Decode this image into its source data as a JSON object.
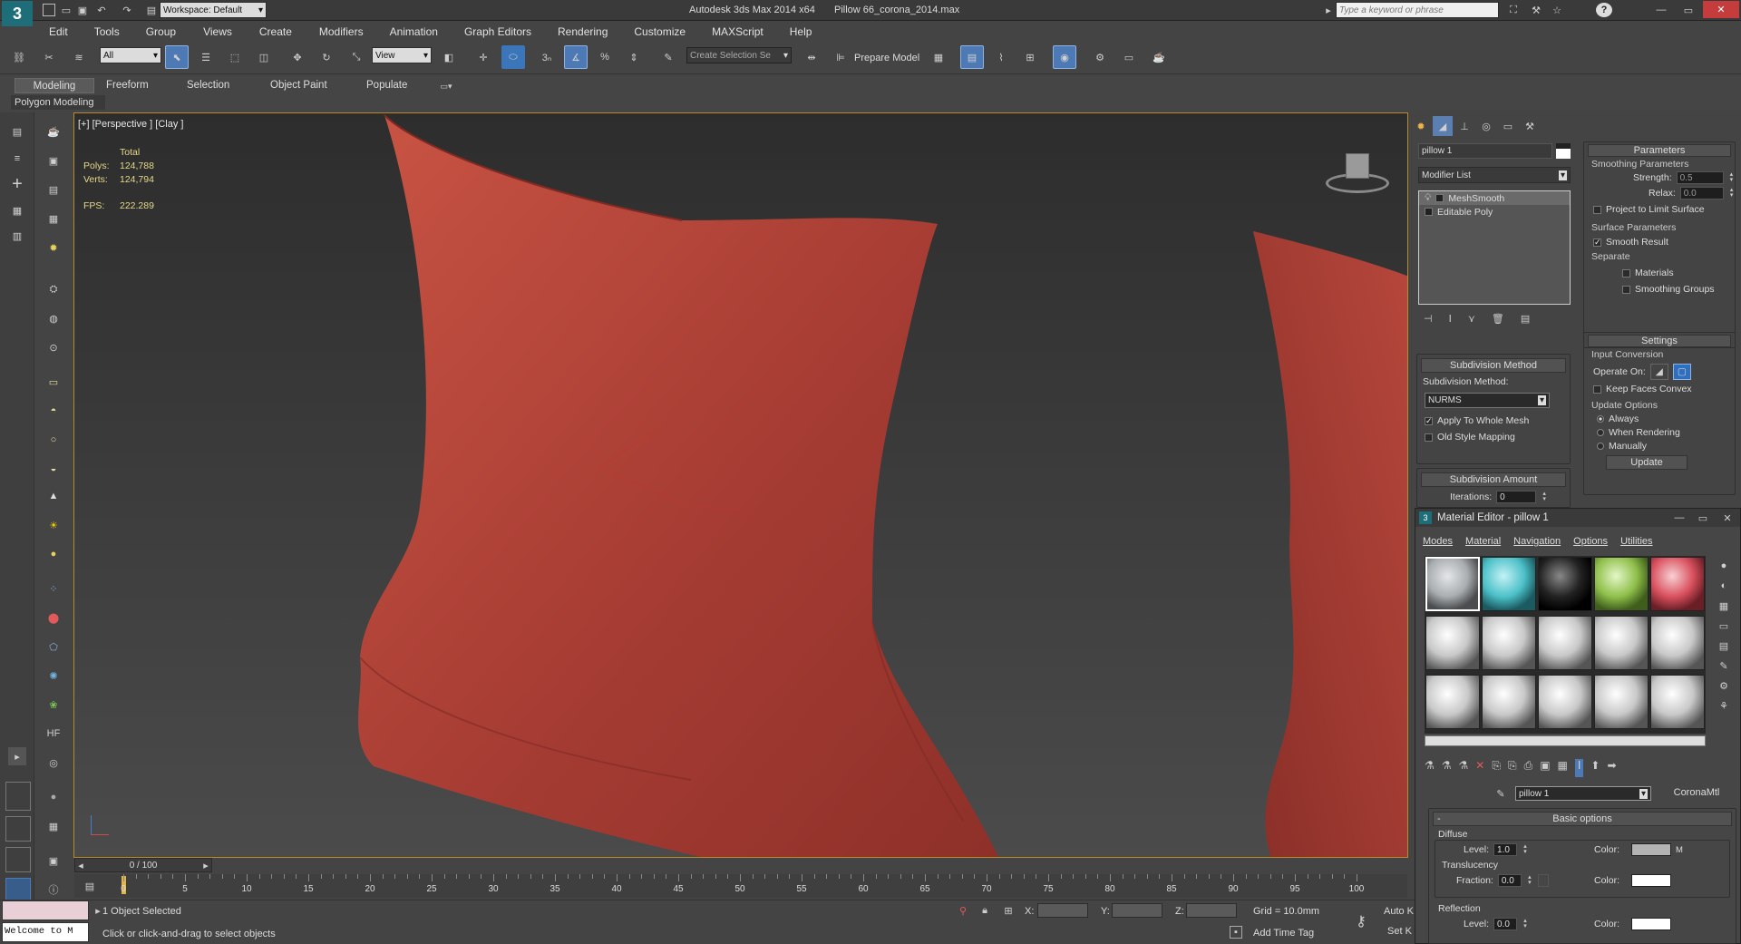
{
  "titlebar": {
    "workspace": "Workspace: Default",
    "app_title": "Autodesk 3ds Max  2014 x64",
    "file_name": "Pillow 66_corona_2014.max",
    "search_placeholder": "Type a keyword or phrase"
  },
  "menu": [
    "Edit",
    "Tools",
    "Group",
    "Views",
    "Create",
    "Modifiers",
    "Animation",
    "Graph Editors",
    "Rendering",
    "Customize",
    "MAXScript",
    "Help"
  ],
  "main_toolbar": {
    "selection_filter": "All",
    "ref_coord": "View",
    "named_selection": "Create Selection Se",
    "prepare_model": "Prepare Model"
  },
  "ribbon": {
    "tabs": [
      "Modeling",
      "Freeform",
      "Selection",
      "Object Paint",
      "Populate"
    ],
    "active_tab": "Modeling",
    "sub_label": "Polygon Modeling"
  },
  "viewport": {
    "label": "[+] [Perspective ] [Clay ]",
    "stats": {
      "total": "Total",
      "polys_label": "Polys:",
      "polys": "124,788",
      "verts_label": "Verts:",
      "verts": "124,794",
      "fps_label": "FPS:",
      "fps": "222.289"
    },
    "model_color": "#b4473b",
    "bg_top": "#2f2f2f",
    "bg_bottom": "#4a4a4a"
  },
  "timeline": {
    "frame": "0 / 100",
    "ticks": [
      "0",
      "5",
      "10",
      "15",
      "20",
      "25",
      "30",
      "35",
      "40",
      "45",
      "50",
      "55",
      "60",
      "65",
      "70",
      "75",
      "80",
      "85",
      "90",
      "95",
      "100"
    ]
  },
  "status": {
    "selected": "1 Object Selected",
    "prompt": "Click or click-and-drag to select objects",
    "grid": "Grid = 10.0mm",
    "add_time_tag": "Add Time Tag",
    "auto_key": "Auto K",
    "set_key": "Set K",
    "maxscript": "Welcome to M",
    "x_label": "X:",
    "y_label": "Y:",
    "z_label": "Z:"
  },
  "command_panel": {
    "object_name": "pillow 1",
    "modifier_list": "Modifier List",
    "stack": [
      "MeshSmooth",
      "Editable Poly"
    ],
    "subdivision_method": {
      "title": "Subdivision Method",
      "label": "Subdivision Method:",
      "value": "NURMS",
      "apply_whole": "Apply To Whole Mesh",
      "old_style": "Old Style Mapping"
    },
    "subdivision_amount": {
      "title": "Subdivision Amount",
      "iterations_label": "Iterations:",
      "iterations": "0"
    },
    "parameters": {
      "title": "Parameters",
      "smoothing": "Smoothing Parameters",
      "strength_label": "Strength:",
      "strength": "0.5",
      "relax_label": "Relax:",
      "relax": "0.0",
      "project": "Project to Limit Surface",
      "surface": "Surface Parameters",
      "smooth_result": "Smooth Result",
      "separate": "Separate",
      "materials": "Materials",
      "smoothing_groups": "Smoothing Groups"
    },
    "settings": {
      "title": "Settings",
      "input_conversion": "Input Conversion",
      "operate_on": "Operate On:",
      "keep_faces": "Keep Faces Convex",
      "update_options": "Update Options",
      "always": "Always",
      "when_rendering": "When Rendering",
      "manually": "Manually",
      "update": "Update"
    }
  },
  "material_editor": {
    "title": "Material Editor - pillow 1",
    "menu": [
      "Modes",
      "Material",
      "Navigation",
      "Options",
      "Utilities"
    ],
    "material_name": "pillow 1",
    "material_type": "CoronaMtl",
    "basic_options": "Basic options",
    "diffuse": "Diffuse",
    "level_label": "Level:",
    "diffuse_level": "1.0",
    "color_label": "Color:",
    "m": "M",
    "translucency": "Translucency",
    "fraction_label": "Fraction:",
    "fraction": "0.0",
    "reflection": "Reflection",
    "reflection_level": "0.0",
    "sample_colors": [
      "#a9adb0",
      "#4cc0c8",
      "#222222",
      "#8fbf4a",
      "#d9505e"
    ]
  }
}
